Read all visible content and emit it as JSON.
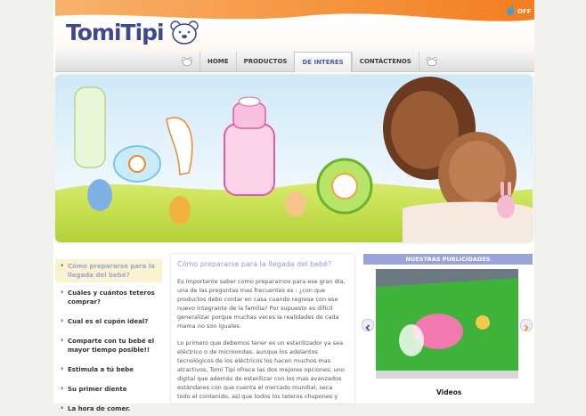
{
  "brand": {
    "name": "TomiTipi",
    "sound_label": "OFF"
  },
  "nav": {
    "items": [
      "HOME",
      "PRODUCTOS",
      "DE INTERES",
      "CONTÁCTENOS"
    ],
    "active": "DE INTERES"
  },
  "sidebar": {
    "items": [
      "Cómo prepararse para la llegada del bebé?",
      "Cuáles y cuántos teteros comprar?",
      "Cual es el cupón ideal?",
      "Comparte con tu bebé el mayor tiempo posible!!",
      "Estimula a tú bebe",
      "Su primer diente",
      "La hora de comer."
    ]
  },
  "article": {
    "title": "Cómo prepararse para la llegada del bebé?",
    "p1": "Es importante saber como prepararnos para ese gran día, una de las preguntas mas frecuentes es : ¿con que productos debo contar en casa cuando regrese con ese nuevo integrante de la familia?  Por supuesto es difícil generalizar porque muchas veces la realidades de cada mama no son iguales.",
    "p2": "Lo primero que debemos tener es un esterilizador ya sea eléctrico o de microondas, aunque los adelantos tecnológicos de los eléctricos los hacen muchos mas atractivos, Tomi Tipi ofrece las dos mejores opciones: uno digital que además de esterilizar con los mas avanzados estándares con que cuenta el mercado mundial, seca todo el contenido, así que todos los teteros chupones y"
  },
  "ads": {
    "header": "NUESTRAS PUBLICIDADES",
    "caption": "Videos"
  },
  "colors": {
    "accent": "#9aa4dc",
    "orange": "#f58a2a",
    "brand_blue": "#3d4a8f",
    "banner_green": "#b8d94a"
  },
  "icons": [
    "bear-logo-icon",
    "sound-icon",
    "arrow-left-icon",
    "arrow-right-icon",
    "play-icon"
  ]
}
